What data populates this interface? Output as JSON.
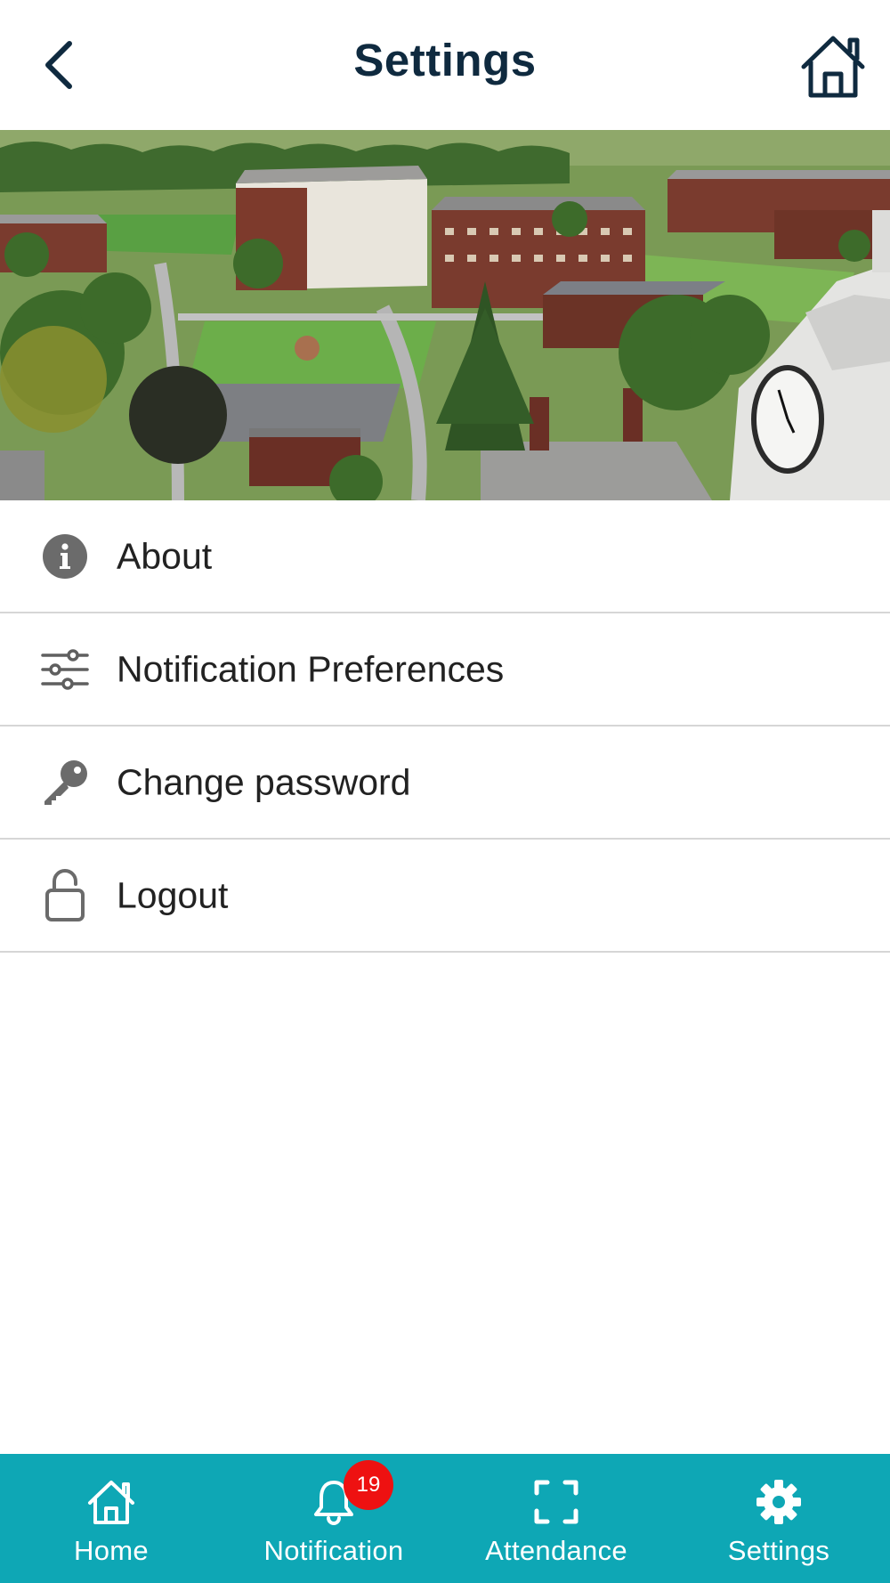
{
  "header": {
    "title": "Settings",
    "back_icon": "chevron-left-icon",
    "home_icon": "home-icon"
  },
  "banner": {
    "image": "campus aerial photo"
  },
  "menu": {
    "items": [
      {
        "label": "About",
        "icon": "info-icon"
      },
      {
        "label": "Notification Preferences",
        "icon": "sliders-icon"
      },
      {
        "label": "Change password",
        "icon": "key-icon"
      },
      {
        "label": "Logout",
        "icon": "unlock-icon"
      }
    ]
  },
  "bottom_nav": {
    "items": [
      {
        "label": "Home",
        "icon": "home-icon"
      },
      {
        "label": "Notification",
        "icon": "bell-icon",
        "badge": "19"
      },
      {
        "label": "Attendance",
        "icon": "scan-frame-icon"
      },
      {
        "label": "Settings",
        "icon": "gear-icon"
      }
    ]
  },
  "colors": {
    "accent": "#0ea7b5",
    "badge": "#ee1111",
    "title": "#0f2a3f",
    "divider": "#d6d6d6"
  }
}
